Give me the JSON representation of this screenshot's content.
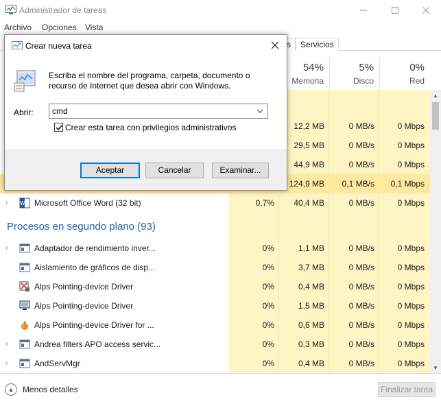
{
  "window": {
    "title": "Administrador de tareas",
    "controls": {
      "minimize": "—",
      "maximize": "☐",
      "close": "✕"
    }
  },
  "menu": [
    "Archivo",
    "Opciones",
    "Vista"
  ],
  "tabs": {
    "partial": "s",
    "services": "Servicios"
  },
  "columns": [
    {
      "pct": "54%",
      "label": "Memoria"
    },
    {
      "pct": "5%",
      "label": "Disco"
    },
    {
      "pct": "0%",
      "label": "Red"
    }
  ],
  "top_rows": [
    {
      "mem": "12,2 MB",
      "disk": "0 MB/s",
      "net": "0 Mbps"
    },
    {
      "mem": "29,5 MB",
      "disk": "0 MB/s",
      "net": "0 Mbps"
    },
    {
      "mem": "44,9 MB",
      "disk": "0 MB/s",
      "net": "0 Mbps"
    },
    {
      "mem": "124,9 MB",
      "disk": "0,1 MB/s",
      "net": "0,1 Mbps"
    }
  ],
  "word_row": {
    "name": "Microsoft Office Word (32 bit)",
    "cpu": "0,7%",
    "mem": "40,4 MB",
    "disk": "0 MB/s",
    "net": "0 Mbps"
  },
  "background_group": {
    "title": "Procesos en segundo plano (93)"
  },
  "background_rows": [
    {
      "name": "Adaptador de rendimiento inver...",
      "cpu": "0%",
      "mem": "1,1 MB",
      "disk": "0 MB/s",
      "net": "0 Mbps",
      "icon": "service-window-icon",
      "expandable": true
    },
    {
      "name": "Aislamiento de gráficos de disp...",
      "cpu": "0%",
      "mem": "3,7 MB",
      "disk": "0 MB/s",
      "net": "0 Mbps",
      "icon": "service-window-icon",
      "expandable": false
    },
    {
      "name": "Alps Pointing-device Driver",
      "cpu": "0%",
      "mem": "0,4 MB",
      "disk": "0 MB/s",
      "net": "0 Mbps",
      "icon": "alps-driver-icon",
      "expandable": false
    },
    {
      "name": "Alps Pointing-device Driver",
      "cpu": "0%",
      "mem": "1,5 MB",
      "disk": "0 MB/s",
      "net": "0 Mbps",
      "icon": "monitor-icon",
      "expandable": false
    },
    {
      "name": "Alps Pointing-device Driver for ...",
      "cpu": "0%",
      "mem": "0,6 MB",
      "disk": "0 MB/s",
      "net": "0 Mbps",
      "icon": "fruit-icon",
      "expandable": false
    },
    {
      "name": "Andrea filters APO access servic...",
      "cpu": "0%",
      "mem": "0,3 MB",
      "disk": "0 MB/s",
      "net": "0 Mbps",
      "icon": "service-window-icon",
      "expandable": true
    },
    {
      "name": "AndServMgr",
      "cpu": "0%",
      "mem": "0,4 MB",
      "disk": "0 MB/s",
      "net": "0 Mbps",
      "icon": "service-window-icon",
      "expandable": true
    }
  ],
  "footer": {
    "less_details": "Menos detalles",
    "end_task": "Finalizar tarea"
  },
  "dialog": {
    "title": "Crear nueva tarea",
    "description": "Escriba el nombre del programa, carpeta, documento o recurso de Internet que desea abrir con Windows.",
    "open_label": "Abrir:",
    "input_value": "cmd",
    "admin_checkbox_label": "Crear esta tarea con privilegios administrativos",
    "admin_checked": true,
    "buttons": {
      "ok": "Aceptar",
      "cancel": "Cancelar",
      "browse": "Examinar..."
    }
  },
  "colors": {
    "accent": "#0078d7",
    "group_title": "#2464a9",
    "heat": "#fff4c4"
  }
}
